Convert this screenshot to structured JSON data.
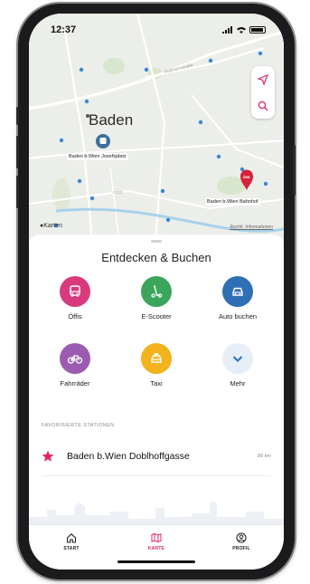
{
  "status": {
    "time": "12:37"
  },
  "map": {
    "city": "Baden",
    "station_josefsplatz": "Baden b.Wien Josefsplatz",
    "station_bahnhof": "Baden b.Wien Bahnhof",
    "maps_credit": "Karten",
    "legal_link": "Rechtl. Informationen",
    "tools": [
      "location-arrow-icon",
      "search-icon"
    ],
    "accent": "#e2236f"
  },
  "sheet": {
    "title": "Entdecken & Buchen",
    "actions": [
      {
        "label": "Öffis",
        "icon": "bus-icon",
        "color": "#d93a7e"
      },
      {
        "label": "E-Scooter",
        "icon": "scooter-icon",
        "color": "#3aa55b"
      },
      {
        "label": "Auto buchen",
        "icon": "car-icon",
        "color": "#2f6fb5"
      },
      {
        "label": "Fahrräder",
        "icon": "bicycle-icon",
        "color": "#9b5bb0"
      },
      {
        "label": "Taxi",
        "icon": "taxi-icon",
        "color": "#f2b31c"
      },
      {
        "label": "Mehr",
        "icon": "chevron-down-icon",
        "color": "#e6eef7"
      }
    ],
    "favorites_heading": "Favorisierte Stationen",
    "favorites": [
      {
        "name": "Baden b.Wien Doblhoffgasse",
        "distance": "89 km"
      }
    ]
  },
  "tabbar": {
    "tabs": [
      {
        "label": "START",
        "icon": "home-icon",
        "active": false
      },
      {
        "label": "KARTE",
        "icon": "map-icon",
        "active": true
      },
      {
        "label": "PROFIL",
        "icon": "profile-icon",
        "active": false
      }
    ]
  }
}
